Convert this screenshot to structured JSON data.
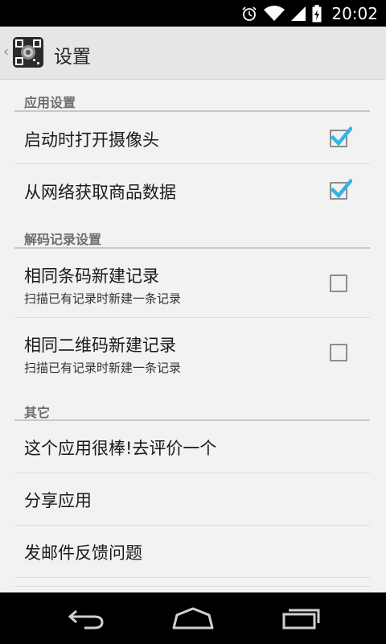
{
  "status_bar": {
    "time": "20:02",
    "icons": [
      "alarm-icon",
      "wifi-icon",
      "signal-icon",
      "battery-charging-icon"
    ]
  },
  "action_bar": {
    "title": "设置",
    "back_icon": "chevron-left-icon",
    "logo_icon": "qr-scanner-app-icon"
  },
  "sections": [
    {
      "title": "应用设置",
      "items": [
        {
          "label": "启动时打开摄像头",
          "checked": true
        },
        {
          "label": "从网络获取商品数据",
          "checked": true
        }
      ]
    },
    {
      "title": "解码记录设置",
      "items": [
        {
          "label": "相同条码新建记录",
          "summary": "扫描已有记录时新建一条记录",
          "checked": false
        },
        {
          "label": "相同二维码新建记录",
          "summary": "扫描已有记录时新建一条记录",
          "checked": false
        }
      ]
    },
    {
      "title": "其它",
      "items": [
        {
          "label": "这个应用很棒!去评价一个"
        },
        {
          "label": "分享应用"
        },
        {
          "label": "发邮件反馈问题"
        }
      ]
    }
  ],
  "nav_bar": {
    "back": "back-icon",
    "home": "home-icon",
    "recents": "recents-icon"
  },
  "colors": {
    "accent": "#33b5e5",
    "background": "#f2f2f2",
    "action_bar": "#e6e6e6"
  }
}
